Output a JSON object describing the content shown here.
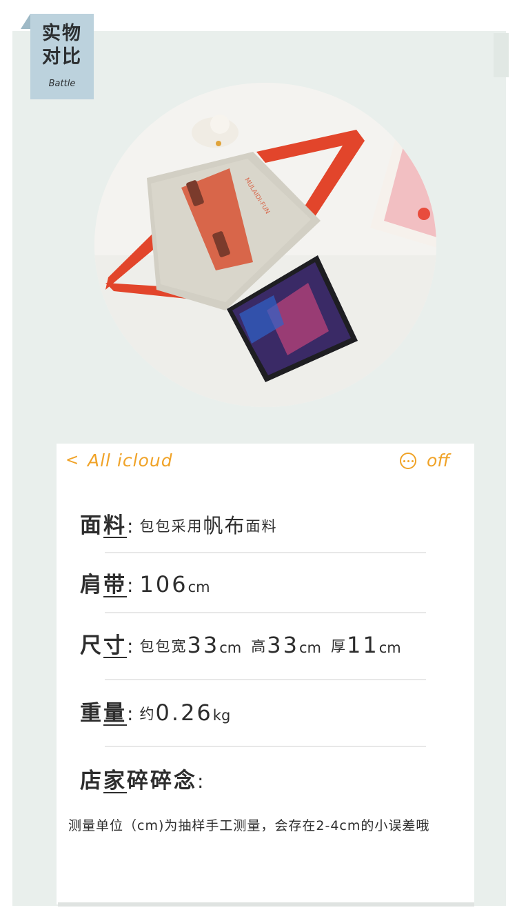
{
  "tag": {
    "title": "实物\n对比",
    "subtitle": "Battle"
  },
  "photo": {
    "bag_text": "MULAIDI-FUN"
  },
  "card": {
    "nav": {
      "back_glyph": "<",
      "back_label": "All icloud",
      "more_label": "off"
    },
    "rows": {
      "material": {
        "label_a": "面",
        "label_b": "料",
        "colon": ":",
        "text_a": "包包采用",
        "text_big": "帆布",
        "text_b": "面料"
      },
      "strap": {
        "label_a": "肩",
        "label_b": "带",
        "colon": ":",
        "value": "106",
        "unit": "cm"
      },
      "size": {
        "label_a": "尺",
        "label_b": "寸",
        "colon": ":",
        "width_label": "包包宽",
        "width_value": "33",
        "height_label": "高",
        "height_value": "33",
        "depth_label": "厚",
        "depth_value": "11",
        "unit": "cm"
      },
      "weight": {
        "label_a": "重",
        "label_b": "量",
        "colon": ":",
        "prefix": "约",
        "value": "0.26",
        "unit": "kg"
      },
      "notes": {
        "label_a": "店",
        "label_b": "家",
        "label_c": "碎碎念",
        "colon": ":"
      }
    },
    "note_text": "测量单位（cm)为抽样手工测量，会存在2-4cm的小误差哦"
  },
  "colors": {
    "accent": "#f0a328",
    "tag_bg": "#bcd2dd",
    "panel_bg": "#e9efec",
    "strap": "#e2452b",
    "flap": "#d9694a"
  }
}
